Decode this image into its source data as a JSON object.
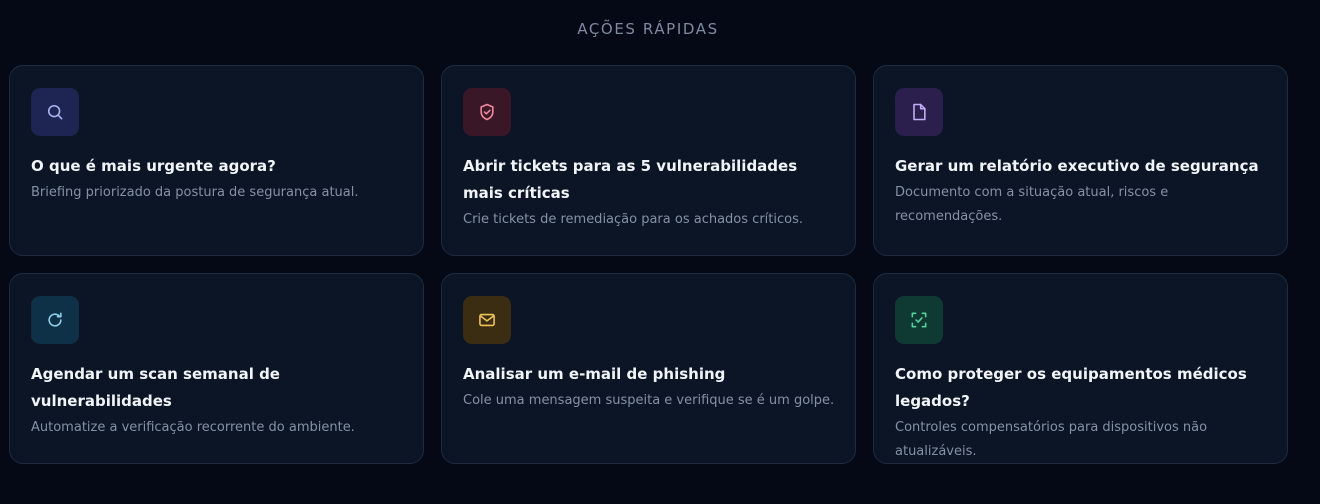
{
  "section": {
    "title": "AÇÕES RÁPIDAS"
  },
  "cards": [
    {
      "icon": "search-icon",
      "color": "#a9b4f2",
      "title": "O que é mais urgente agora?",
      "description": "Briefing priorizado da postura de segurança atual."
    },
    {
      "icon": "shield-check-icon",
      "color": "#f18aa0",
      "title": "Abrir tickets para as 5 vulnerabilidades mais críticas",
      "description": "Crie tickets de remediação para os achados críticos."
    },
    {
      "icon": "document-icon",
      "color": "#c1aef6",
      "title": "Gerar um relatório executivo de segurança",
      "description": "Documento com a situação atual, riscos e recomendações."
    },
    {
      "icon": "refresh-icon",
      "color": "#8fd2ee",
      "title": "Agendar um scan semanal de vulnerabilidades",
      "description": "Automatize a verificação recorrente do ambiente."
    },
    {
      "icon": "mail-icon",
      "color": "#f0c35a",
      "title": "Analisar um e-mail de phishing",
      "description": "Cole uma mensagem suspeita e verifique se é um golpe."
    },
    {
      "icon": "scan-check-icon",
      "color": "#55d09b",
      "title": "Como proteger os equipamentos médicos legados?",
      "description": "Controles compensatórios para dispositivos não atualizáveis."
    }
  ]
}
